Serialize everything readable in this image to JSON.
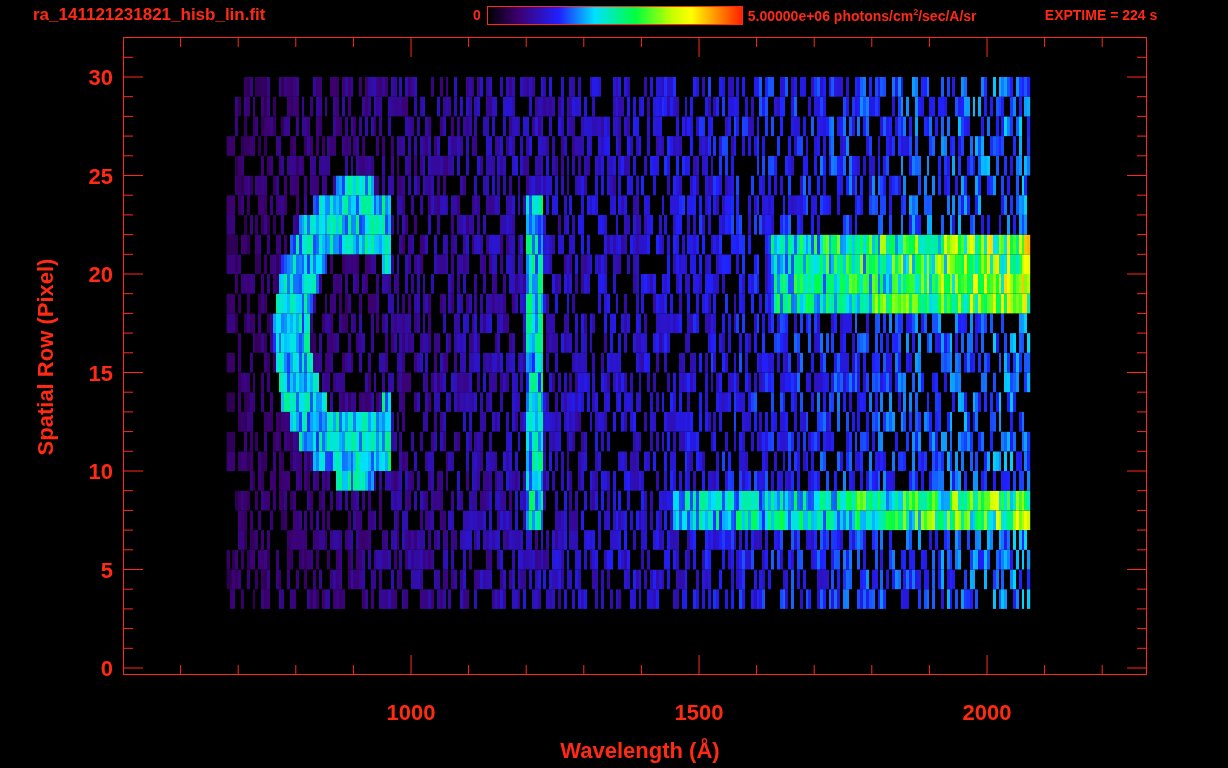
{
  "header": {
    "filename": "ra_141121231821_hisb_lin.fit",
    "colorbar": {
      "min_label": "0",
      "max_label": "5.00000e+06 photons/cm$^{2}$/sec/A/sr"
    },
    "exposure": "EXPTIME = 224 s"
  },
  "plot": {
    "ylabel": "Spatial Row (Pixel)",
    "xlabel": "Wavelength (Å)",
    "yticks": [
      "30",
      "25",
      "20",
      "15",
      "10",
      "5",
      "0"
    ],
    "xticks": [
      "1000",
      "1500",
      "2000"
    ]
  }
}
